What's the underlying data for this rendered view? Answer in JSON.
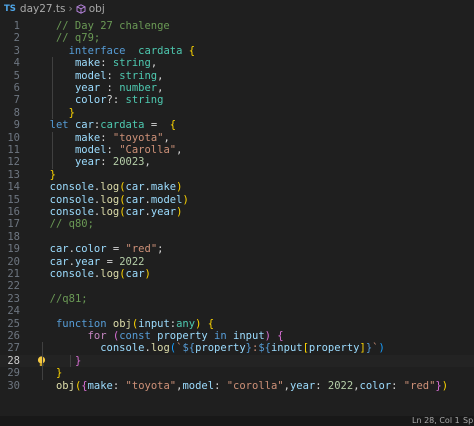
{
  "breadcrumb": {
    "lang_badge": "TS",
    "file": "day27.ts",
    "symbol": "obj"
  },
  "status": {
    "position": "Ln 28, Col 1",
    "extra": "Sp"
  },
  "lines": [
    {
      "num": "1",
      "tokens": [
        [
          "   ",
          ""
        ],
        [
          "// Day 27 chalenge",
          "com"
        ]
      ]
    },
    {
      "num": "2",
      "tokens": [
        [
          "   ",
          ""
        ],
        [
          "// q79;",
          "com"
        ]
      ]
    },
    {
      "num": "3",
      "tokens": [
        [
          "     ",
          ""
        ],
        [
          "interface",
          "kw"
        ],
        [
          "  ",
          ""
        ],
        [
          "cardata",
          "type"
        ],
        [
          " ",
          ""
        ],
        [
          "{",
          "b1"
        ]
      ]
    },
    {
      "num": "4",
      "tokens": [
        [
          "      ",
          ""
        ],
        [
          "make",
          "var"
        ],
        [
          ": ",
          "pun"
        ],
        [
          "string",
          "type"
        ],
        [
          ",",
          "pun"
        ]
      ]
    },
    {
      "num": "5",
      "tokens": [
        [
          "      ",
          ""
        ],
        [
          "model",
          "var"
        ],
        [
          ": ",
          "pun"
        ],
        [
          "string",
          "type"
        ],
        [
          ",",
          "pun"
        ]
      ]
    },
    {
      "num": "6",
      "tokens": [
        [
          "      ",
          ""
        ],
        [
          "year",
          "var"
        ],
        [
          " : ",
          "pun"
        ],
        [
          "number",
          "type"
        ],
        [
          ",",
          "pun"
        ]
      ]
    },
    {
      "num": "7",
      "tokens": [
        [
          "      ",
          ""
        ],
        [
          "color",
          "var"
        ],
        [
          "?: ",
          "pun"
        ],
        [
          "string",
          "type"
        ]
      ]
    },
    {
      "num": "8",
      "tokens": [
        [
          "     ",
          ""
        ],
        [
          "}",
          "b1"
        ]
      ]
    },
    {
      "num": "9",
      "tokens": [
        [
          "  ",
          ""
        ],
        [
          "let",
          "kw"
        ],
        [
          " ",
          ""
        ],
        [
          "car",
          "var"
        ],
        [
          ":",
          "pun"
        ],
        [
          "cardata",
          "type"
        ],
        [
          " = ",
          "pun"
        ],
        [
          " {",
          "b1"
        ]
      ]
    },
    {
      "num": "10",
      "tokens": [
        [
          "      ",
          ""
        ],
        [
          "make",
          "var"
        ],
        [
          ": ",
          "pun"
        ],
        [
          "\"toyota\"",
          "str"
        ],
        [
          ",",
          "pun"
        ]
      ]
    },
    {
      "num": "11",
      "tokens": [
        [
          "      ",
          ""
        ],
        [
          "model",
          "var"
        ],
        [
          ": ",
          "pun"
        ],
        [
          "\"Carolla\"",
          "str"
        ],
        [
          ",",
          "pun"
        ]
      ]
    },
    {
      "num": "12",
      "tokens": [
        [
          "      ",
          ""
        ],
        [
          "year",
          "var"
        ],
        [
          ": ",
          "pun"
        ],
        [
          "20023",
          "num"
        ],
        [
          ",",
          "pun"
        ]
      ]
    },
    {
      "num": "13",
      "tokens": [
        [
          "  ",
          ""
        ],
        [
          "}",
          "b1"
        ]
      ]
    },
    {
      "num": "14",
      "tokens": [
        [
          "  ",
          ""
        ],
        [
          "console",
          "var"
        ],
        [
          ".",
          "pun"
        ],
        [
          "log",
          "fn"
        ],
        [
          "(",
          "b1"
        ],
        [
          "car",
          "var"
        ],
        [
          ".",
          "pun"
        ],
        [
          "make",
          "var"
        ],
        [
          ")",
          "b1"
        ]
      ]
    },
    {
      "num": "15",
      "tokens": [
        [
          "  ",
          ""
        ],
        [
          "console",
          "var"
        ],
        [
          ".",
          "pun"
        ],
        [
          "log",
          "fn"
        ],
        [
          "(",
          "b1"
        ],
        [
          "car",
          "var"
        ],
        [
          ".",
          "pun"
        ],
        [
          "model",
          "var"
        ],
        [
          ")",
          "b1"
        ]
      ]
    },
    {
      "num": "16",
      "tokens": [
        [
          "  ",
          ""
        ],
        [
          "console",
          "var"
        ],
        [
          ".",
          "pun"
        ],
        [
          "log",
          "fn"
        ],
        [
          "(",
          "b1"
        ],
        [
          "car",
          "var"
        ],
        [
          ".",
          "pun"
        ],
        [
          "year",
          "var"
        ],
        [
          ")",
          "b1"
        ]
      ]
    },
    {
      "num": "17",
      "tokens": [
        [
          "  ",
          ""
        ],
        [
          "// q80;",
          "com"
        ]
      ]
    },
    {
      "num": "18",
      "tokens": []
    },
    {
      "num": "19",
      "tokens": [
        [
          "  ",
          ""
        ],
        [
          "car",
          "var"
        ],
        [
          ".",
          "pun"
        ],
        [
          "color",
          "var"
        ],
        [
          " = ",
          "pun"
        ],
        [
          "\"red\"",
          "str"
        ],
        [
          ";",
          "pun"
        ]
      ]
    },
    {
      "num": "20",
      "tokens": [
        [
          "  ",
          ""
        ],
        [
          "car",
          "var"
        ],
        [
          ".",
          "pun"
        ],
        [
          "year",
          "var"
        ],
        [
          " = ",
          "pun"
        ],
        [
          "2022",
          "num"
        ]
      ]
    },
    {
      "num": "21",
      "tokens": [
        [
          "  ",
          ""
        ],
        [
          "console",
          "var"
        ],
        [
          ".",
          "pun"
        ],
        [
          "log",
          "fn"
        ],
        [
          "(",
          "b1"
        ],
        [
          "car",
          "var"
        ],
        [
          ")",
          "b1"
        ]
      ]
    },
    {
      "num": "22",
      "tokens": []
    },
    {
      "num": "23",
      "tokens": [
        [
          "  ",
          ""
        ],
        [
          "//q81;",
          "com"
        ]
      ]
    },
    {
      "num": "24",
      "tokens": []
    },
    {
      "num": "25",
      "tokens": [
        [
          "   ",
          ""
        ],
        [
          "function",
          "kw"
        ],
        [
          " ",
          ""
        ],
        [
          "obj",
          "fn"
        ],
        [
          "(",
          "b1"
        ],
        [
          "input",
          "var"
        ],
        [
          ":",
          "pun"
        ],
        [
          "any",
          "type"
        ],
        [
          ")",
          "b1"
        ],
        [
          " ",
          ""
        ],
        [
          "{",
          "b1"
        ]
      ]
    },
    {
      "num": "26",
      "tokens": [
        [
          "        ",
          ""
        ],
        [
          "for",
          "ctl"
        ],
        [
          " ",
          ""
        ],
        [
          "(",
          "b2"
        ],
        [
          "const",
          "kw"
        ],
        [
          " ",
          ""
        ],
        [
          "property",
          "var"
        ],
        [
          " ",
          ""
        ],
        [
          "in",
          "kw"
        ],
        [
          " ",
          ""
        ],
        [
          "input",
          "var"
        ],
        [
          ")",
          "b2"
        ],
        [
          " ",
          ""
        ],
        [
          "{",
          "b2"
        ]
      ]
    },
    {
      "num": "27",
      "tokens": [
        [
          "          ",
          ""
        ],
        [
          "console",
          "var"
        ],
        [
          ".",
          "pun"
        ],
        [
          "log",
          "fn"
        ],
        [
          "(",
          "b3"
        ],
        [
          "`",
          "str"
        ],
        [
          "${",
          "kw"
        ],
        [
          "property",
          "var"
        ],
        [
          "}",
          "kw"
        ],
        [
          ":",
          "str"
        ],
        [
          "${",
          "kw"
        ],
        [
          "input",
          "var"
        ],
        [
          "[",
          "b1"
        ],
        [
          "property",
          "var"
        ],
        [
          "]",
          "b1"
        ],
        [
          "}",
          "kw"
        ],
        [
          "`",
          "str"
        ],
        [
          ")",
          "b3"
        ]
      ]
    },
    {
      "num": "28",
      "tokens": [
        [
          "      ",
          ""
        ],
        [
          "}",
          "b2"
        ]
      ],
      "current": true,
      "bulb": true
    },
    {
      "num": "29",
      "tokens": [
        [
          "   ",
          ""
        ],
        [
          "}",
          "b1"
        ]
      ]
    },
    {
      "num": "30",
      "tokens": [
        [
          "   ",
          ""
        ],
        [
          "obj",
          "fn"
        ],
        [
          "(",
          "b1"
        ],
        [
          "{",
          "b2"
        ],
        [
          "make",
          "var"
        ],
        [
          ": ",
          "pun"
        ],
        [
          "\"toyota\"",
          "str"
        ],
        [
          ",",
          "pun"
        ],
        [
          "model",
          "var"
        ],
        [
          ": ",
          "pun"
        ],
        [
          "\"corolla\"",
          "str"
        ],
        [
          ",",
          "pun"
        ],
        [
          "year",
          "var"
        ],
        [
          ": ",
          "pun"
        ],
        [
          "2022",
          "num"
        ],
        [
          ",",
          "pun"
        ],
        [
          "color",
          "var"
        ],
        [
          ": ",
          "pun"
        ],
        [
          "\"red\"",
          "str"
        ],
        [
          "}",
          "b2"
        ],
        [
          ")",
          "b1"
        ]
      ]
    }
  ]
}
